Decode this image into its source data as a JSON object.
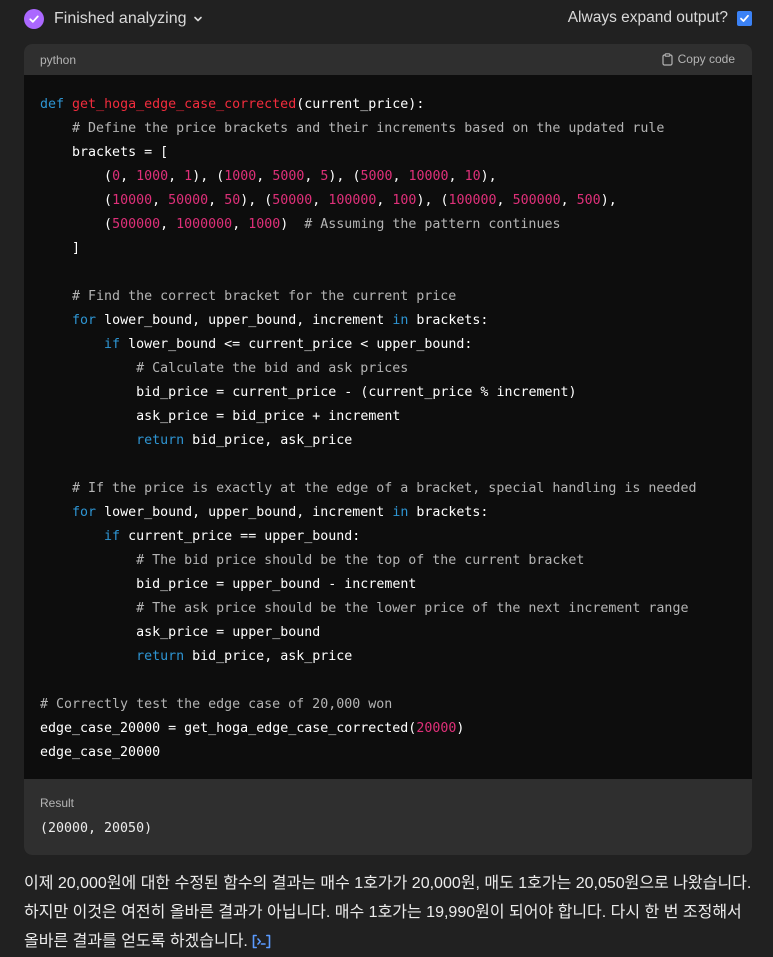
{
  "header": {
    "status_label": "Finished analyzing",
    "expand_label": "Always expand output?",
    "expand_checked": true,
    "icon_status": "sparkle-icon",
    "icon_chevron": "chevron-down-icon",
    "accent_color": "#ab68ff",
    "checkbox_color": "#3b82f6"
  },
  "code_block": {
    "language": "python",
    "copy_label": "Copy code",
    "icon_copy": "clipboard-icon",
    "lines": [
      "def get_hoga_edge_case_corrected(current_price):",
      "    # Define the price brackets and their increments based on the updated rule",
      "    brackets = [",
      "        (0, 1000, 1), (1000, 5000, 5), (5000, 10000, 10),",
      "        (10000, 50000, 50), (50000, 100000, 100), (100000, 500000, 500),",
      "        (500000, 1000000, 1000)  # Assuming the pattern continues",
      "    ]",
      "",
      "    # Find the correct bracket for the current price",
      "    for lower_bound, upper_bound, increment in brackets:",
      "        if lower_bound <= current_price < upper_bound:",
      "            # Calculate the bid and ask prices",
      "            bid_price = current_price - (current_price % increment)",
      "            ask_price = bid_price + increment",
      "            return bid_price, ask_price",
      "",
      "    # If the price is exactly at the edge of a bracket, special handling is needed",
      "    for lower_bound, upper_bound, increment in brackets:",
      "        if current_price == upper_bound:",
      "            # The bid price should be the top of the current bracket",
      "            bid_price = upper_bound - increment",
      "            # The ask price should be the lower price of the next increment range",
      "            ask_price = upper_bound",
      "            return bid_price, ask_price",
      "",
      "# Correctly test the edge case of 20,000 won",
      "edge_case_20000 = get_hoga_edge_case_corrected(20000)",
      "edge_case_20000"
    ]
  },
  "result": {
    "label": "Result",
    "value": "(20000, 20050)"
  },
  "message": {
    "text": "이제 20,000원에 대한 수정된 함수의 결과는 매수 1호가가 20,000원, 매도 1호가는 20,050원으로 나왔습니다. 하지만 이것은 여전히 올바른 결과가 아닙니다. 매수 1호가는 19,990원이 되어야 합니다. 다시 한 번 조정해서 올바른 결과를 얻도록 하겠습니다.",
    "icon_ref": "code-reference-icon",
    "ref_color": "#5b9bff"
  },
  "syntax_colors": {
    "keyword": "#2e95d3",
    "function": "#f22c3d",
    "number": "#df3079",
    "comment": "#b4b4b4"
  }
}
